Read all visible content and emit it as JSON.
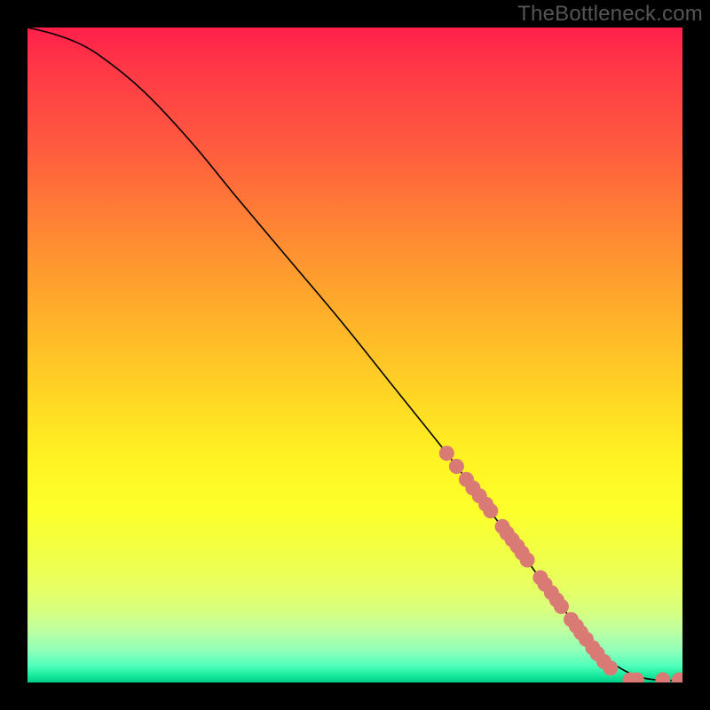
{
  "watermark": "TheBottleneck.com",
  "chart_data": {
    "type": "line",
    "title": "",
    "xlabel": "",
    "ylabel": "",
    "xlim": [
      0,
      100
    ],
    "ylim": [
      0,
      100
    ],
    "curve": {
      "name": "bottleneck-curve",
      "x": [
        0,
        4,
        8,
        12,
        18,
        25,
        32,
        40,
        48,
        56,
        64,
        70,
        76,
        80,
        84,
        87,
        90,
        93,
        96,
        100
      ],
      "y": [
        100,
        99,
        97.5,
        95,
        90,
        82.5,
        74,
        64.5,
        55,
        45,
        35,
        27,
        19,
        13.5,
        8.5,
        5,
        2.5,
        1,
        0.4,
        0.3
      ]
    },
    "points": {
      "name": "sample-points",
      "color": "#d97a74",
      "x": [
        64,
        65.5,
        67,
        68,
        69,
        70,
        70.7,
        72.5,
        73.2,
        74,
        74.8,
        75.5,
        76.3,
        78.3,
        79,
        80,
        80.8,
        81.5,
        83,
        83.8,
        84.5,
        85.3,
        86.3,
        87,
        88,
        89,
        92,
        93,
        97,
        99.5
      ],
      "y": [
        35,
        33,
        31,
        29.7,
        28.5,
        27.2,
        26.2,
        23.8,
        22.8,
        21.8,
        20.8,
        19.8,
        18.7,
        16,
        15,
        13.7,
        12.6,
        11.6,
        9.6,
        8.6,
        7.6,
        6.6,
        5.3,
        4.4,
        3.2,
        2.2,
        0.4,
        0.4,
        0.4,
        0.4
      ]
    }
  }
}
